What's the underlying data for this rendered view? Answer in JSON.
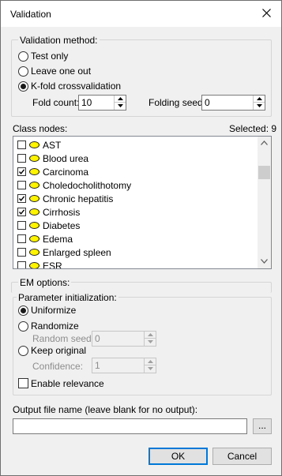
{
  "window": {
    "title": "Validation",
    "close_icon": "close-icon"
  },
  "validation": {
    "group_label": "Validation method:",
    "options": [
      {
        "label": "Test only",
        "checked": false
      },
      {
        "label": "Leave one out",
        "checked": false
      },
      {
        "label": "K-fold crossvalidation",
        "checked": true
      }
    ],
    "fold_count_label": "Fold count:",
    "fold_count_value": "10",
    "folding_seed_label": "Folding seed:",
    "folding_seed_value": "0"
  },
  "class_nodes": {
    "label": "Class nodes:",
    "selected_label": "Selected: 9",
    "items": [
      {
        "label": "AST",
        "checked": false
      },
      {
        "label": "Blood urea",
        "checked": false
      },
      {
        "label": "Carcinoma",
        "checked": true
      },
      {
        "label": "Choledocholithotomy",
        "checked": false
      },
      {
        "label": "Chronic hepatitis",
        "checked": true
      },
      {
        "label": "Cirrhosis",
        "checked": true
      },
      {
        "label": "Diabetes",
        "checked": false
      },
      {
        "label": "Edema",
        "checked": false
      },
      {
        "label": "Enlarged spleen",
        "checked": false
      },
      {
        "label": "ESR",
        "checked": false
      }
    ],
    "node_color": "#fff400"
  },
  "em": {
    "group_label": "EM options:",
    "param_label": "Parameter initialization:",
    "uniformize": "Uniformize",
    "randomize": "Randomize",
    "random_seed_label": "Random seed:",
    "random_seed_value": "0",
    "keep_original": "Keep original",
    "confidence_label": "Confidence:",
    "confidence_value": "1",
    "enable_relevance": "Enable relevance",
    "selected_init": "Uniformize"
  },
  "output": {
    "label": "Output file name (leave blank for no output):",
    "value": "",
    "browse_label": "..."
  },
  "buttons": {
    "ok": "OK",
    "cancel": "Cancel"
  },
  "colors": {
    "accent": "#0078d7"
  }
}
